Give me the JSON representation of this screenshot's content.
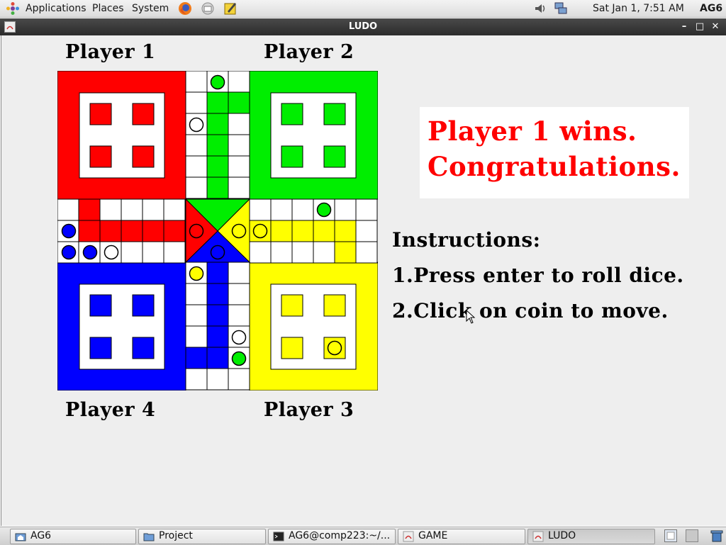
{
  "top_panel": {
    "menus": [
      "Applications",
      "Places",
      "System"
    ],
    "clock": "Sat Jan  1,  7:51 AM",
    "user": "AG6"
  },
  "window": {
    "title": "LUDO"
  },
  "board": {
    "player_labels": {
      "p1": "Player 1",
      "p2": "Player 2",
      "p3": "Player 3",
      "p4": "Player 4"
    },
    "colors": {
      "red": "#ff0000",
      "green": "#00ee00",
      "yellow": "#ffff00",
      "blue": "#0000ff"
    }
  },
  "status": {
    "line1": "Player 1 wins.",
    "line2": "Congratulations."
  },
  "instructions": {
    "heading": "Instructions:",
    "step1": "1.Press enter to roll dice.",
    "step2": "2.Click on coin to move."
  },
  "taskbar": {
    "tasks": [
      "AG6",
      "Project",
      "AG6@comp223:~/...",
      "GAME",
      "LUDO"
    ]
  }
}
